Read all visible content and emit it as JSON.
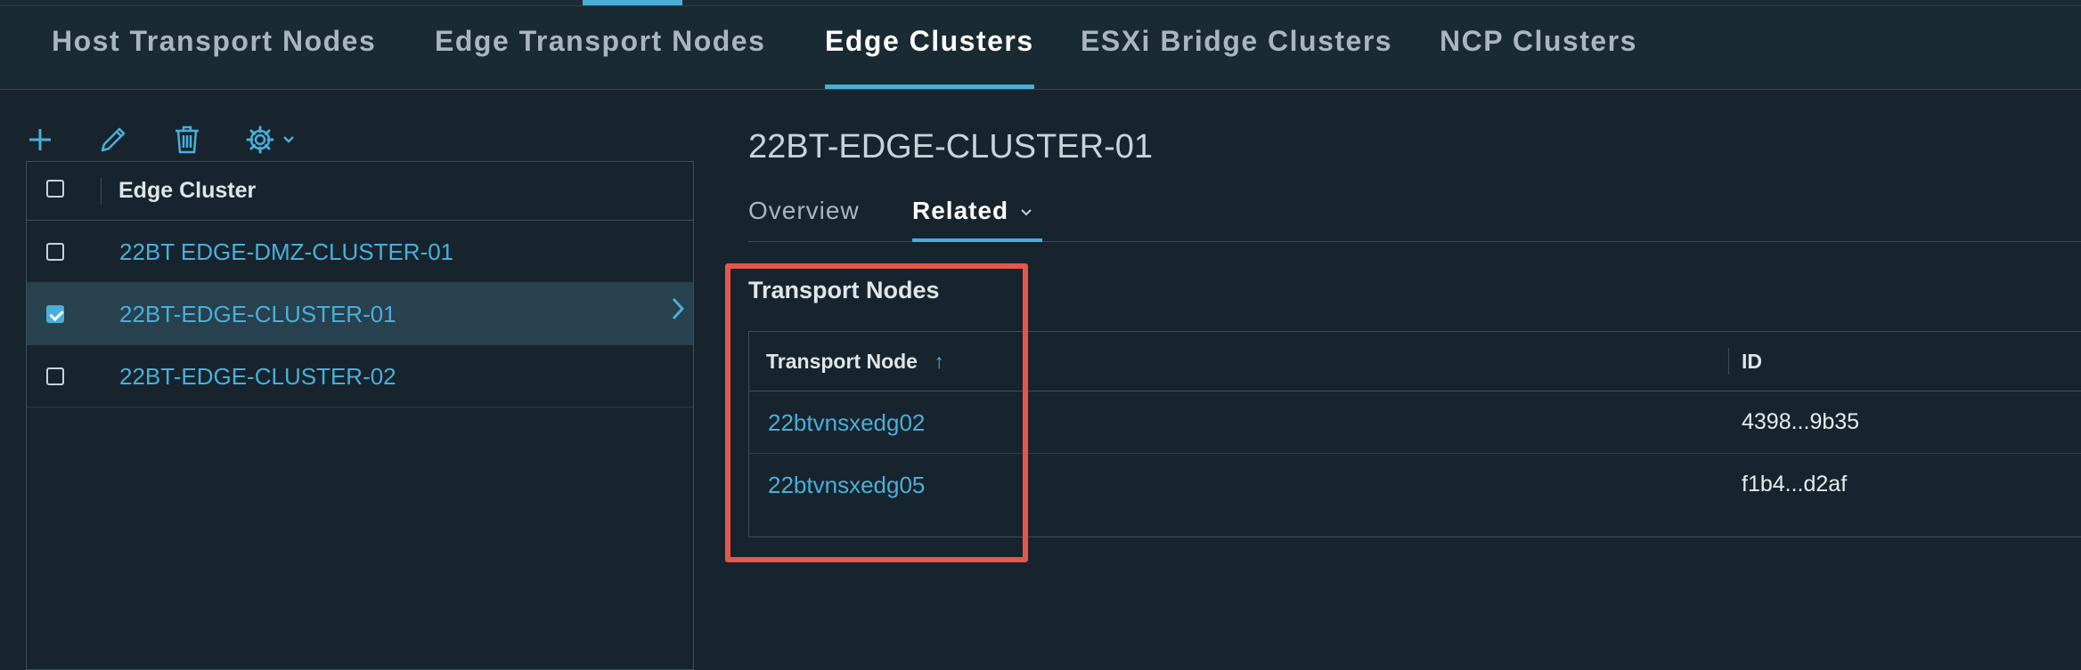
{
  "nav": {
    "tabs": [
      {
        "label": "Host Transport Nodes"
      },
      {
        "label": "Edge Transport Nodes"
      },
      {
        "label": "Edge Clusters"
      },
      {
        "label": "ESXi Bridge Clusters"
      },
      {
        "label": "NCP Clusters"
      }
    ],
    "active_tab": "Edge Clusters"
  },
  "toolbar": {
    "icons": [
      "add-icon",
      "edit-icon",
      "delete-icon",
      "gear-icon",
      "chevron-down-icon"
    ]
  },
  "list": {
    "column_header": "Edge Cluster",
    "rows": [
      {
        "name": "22BT EDGE-DMZ-CLUSTER-01",
        "checked": false
      },
      {
        "name": "22BT-EDGE-CLUSTER-01",
        "checked": true
      },
      {
        "name": "22BT-EDGE-CLUSTER-02",
        "checked": false
      }
    ]
  },
  "detail": {
    "title": "22BT-EDGE-CLUSTER-01",
    "tabs": [
      {
        "label": "Overview"
      },
      {
        "label": "Related"
      }
    ],
    "active_tab": "Related",
    "section_title": "Transport Nodes",
    "table": {
      "headers": {
        "transport_node": "Transport Node",
        "id": "ID"
      },
      "sort_indicator": "↑",
      "rows": [
        {
          "transport_node": "22btvnsxedg02",
          "id": "4398...9b35"
        },
        {
          "transport_node": "22btvnsxedg05",
          "id": "f1b4...d2af"
        }
      ]
    }
  },
  "colors": {
    "accent": "#49afd9",
    "highlight": "#e8564a",
    "background": "#17242d"
  }
}
